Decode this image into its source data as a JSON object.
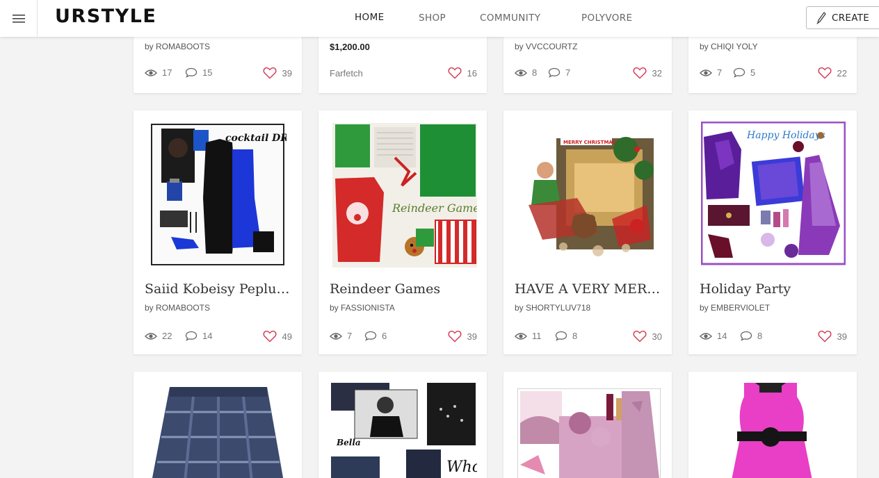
{
  "header": {
    "logo": "URSTYLE",
    "nav": [
      "HOME",
      "SHOP",
      "COMMUNITY",
      "POLYVORE"
    ],
    "create_label": "CREATE"
  },
  "top_row": [
    {
      "by": "by ROMABOOTS",
      "views": "17",
      "comments": "15",
      "likes": "39"
    },
    {
      "price": "$1,200.00",
      "store": "Farfetch",
      "likes": "16"
    },
    {
      "by": "by VVCCOURTZ",
      "views": "8",
      "comments": "7",
      "likes": "32"
    },
    {
      "by": "by CHIQI YOLY",
      "views": "7",
      "comments": "5",
      "likes": "22"
    }
  ],
  "cards": [
    {
      "title": "Saiid Kobeisy Peplum...",
      "by": "by ROMABOOTS",
      "views": "22",
      "comments": "14",
      "likes": "49",
      "image_text": "cocktail DRESS"
    },
    {
      "title": "Reindeer Games",
      "by": "by FASSIONISTA",
      "views": "7",
      "comments": "6",
      "likes": "39",
      "image_text": "Reindeer Games"
    },
    {
      "title": "HAVE A VERY MERRY...",
      "by": "by SHORTYLUV718",
      "views": "11",
      "comments": "8",
      "likes": "30",
      "image_text": "MERRY CHRISTMAS"
    },
    {
      "title": "Holiday Party",
      "by": "by EMBERVIOLET",
      "views": "14",
      "comments": "8",
      "likes": "39",
      "image_text": "Happy Holidays"
    }
  ],
  "bottom_row": [
    {
      "image_text": ""
    },
    {
      "image_text": "Bella"
    },
    {
      "image_text": ""
    },
    {
      "image_text": ""
    }
  ],
  "colors": {
    "heart": "#d6405a",
    "background": "#f3f3f3"
  }
}
